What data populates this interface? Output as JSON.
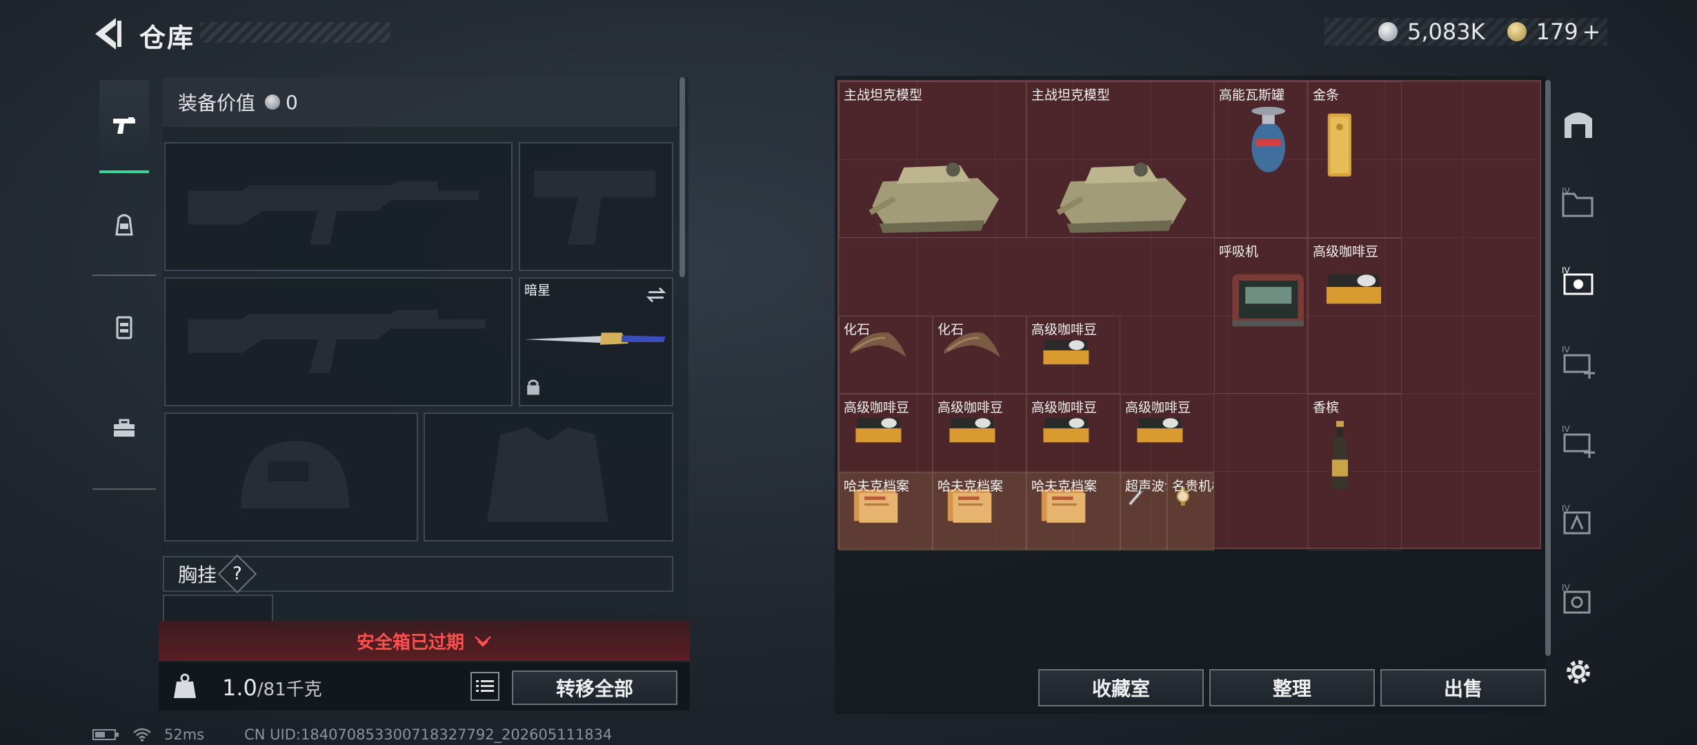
{
  "header": {
    "title": "仓库",
    "silver_amount": "5,083K",
    "gold_amount": "179",
    "gold_plus": "+"
  },
  "left_rail": {
    "items": [
      {
        "name": "firearms",
        "icon": "pistol-icon",
        "active": true
      },
      {
        "name": "armor",
        "icon": "backpack-icon",
        "active": false
      },
      {
        "name": "rig",
        "icon": "vest-icon",
        "active": false
      },
      {
        "name": "tools",
        "icon": "toolbox-icon",
        "active": false
      }
    ]
  },
  "equipment": {
    "value_label": "装备价值",
    "value_amount": "0",
    "melee_name": "暗星",
    "chest_rig_label": "胸挂",
    "help_glyph": "?"
  },
  "safebox": {
    "expired_text": "安全箱已过期"
  },
  "capacity": {
    "current": "1.0",
    "max_text": "/81千克"
  },
  "buttons": {
    "transfer_all": "转移全部",
    "collection_room": "收藏室",
    "organize": "整理",
    "sell": "出售"
  },
  "stash_items": [
    {
      "name": "主战坦克模型",
      "icon": "tank-model-icon"
    },
    {
      "name": "主战坦克模型",
      "icon": "tank-model-icon"
    },
    {
      "name": "高能瓦斯罐",
      "icon": "gas-canister-icon"
    },
    {
      "name": "金条",
      "icon": "gold-bar-icon"
    },
    {
      "name": "呼吸机",
      "icon": "ventilator-icon"
    },
    {
      "name": "高级咖啡豆",
      "icon": "coffee-bag-icon"
    },
    {
      "name": "化石",
      "icon": "fossil-claw-icon"
    },
    {
      "name": "化石",
      "icon": "fossil-claw-icon"
    },
    {
      "name": "高级咖啡豆",
      "icon": "coffee-bag-icon"
    },
    {
      "name": "高级咖啡豆",
      "icon": "coffee-bag-icon"
    },
    {
      "name": "高级咖啡豆",
      "icon": "coffee-bag-icon"
    },
    {
      "name": "高级咖啡豆",
      "icon": "coffee-bag-icon"
    },
    {
      "name": "高级咖啡豆",
      "icon": "coffee-bag-icon"
    },
    {
      "name": "香槟",
      "icon": "champagne-icon"
    },
    {
      "name": "哈夫克档案",
      "icon": "dossier-icon"
    },
    {
      "name": "哈夫克档案",
      "icon": "dossier-icon"
    },
    {
      "name": "哈夫克档案",
      "icon": "dossier-icon"
    },
    {
      "name": "超声波切...",
      "icon": "ultrasonic-cutter-icon"
    },
    {
      "name": "名贵机械表",
      "icon": "watch-icon"
    }
  ],
  "status": {
    "ping": "52ms",
    "uid": "CN UID:18407085330071832779​2_202605111834"
  },
  "colors": {
    "accent_green": "#3ed39a",
    "warning_red": "#ff4f4f",
    "stash_bg": "#4c262b"
  }
}
